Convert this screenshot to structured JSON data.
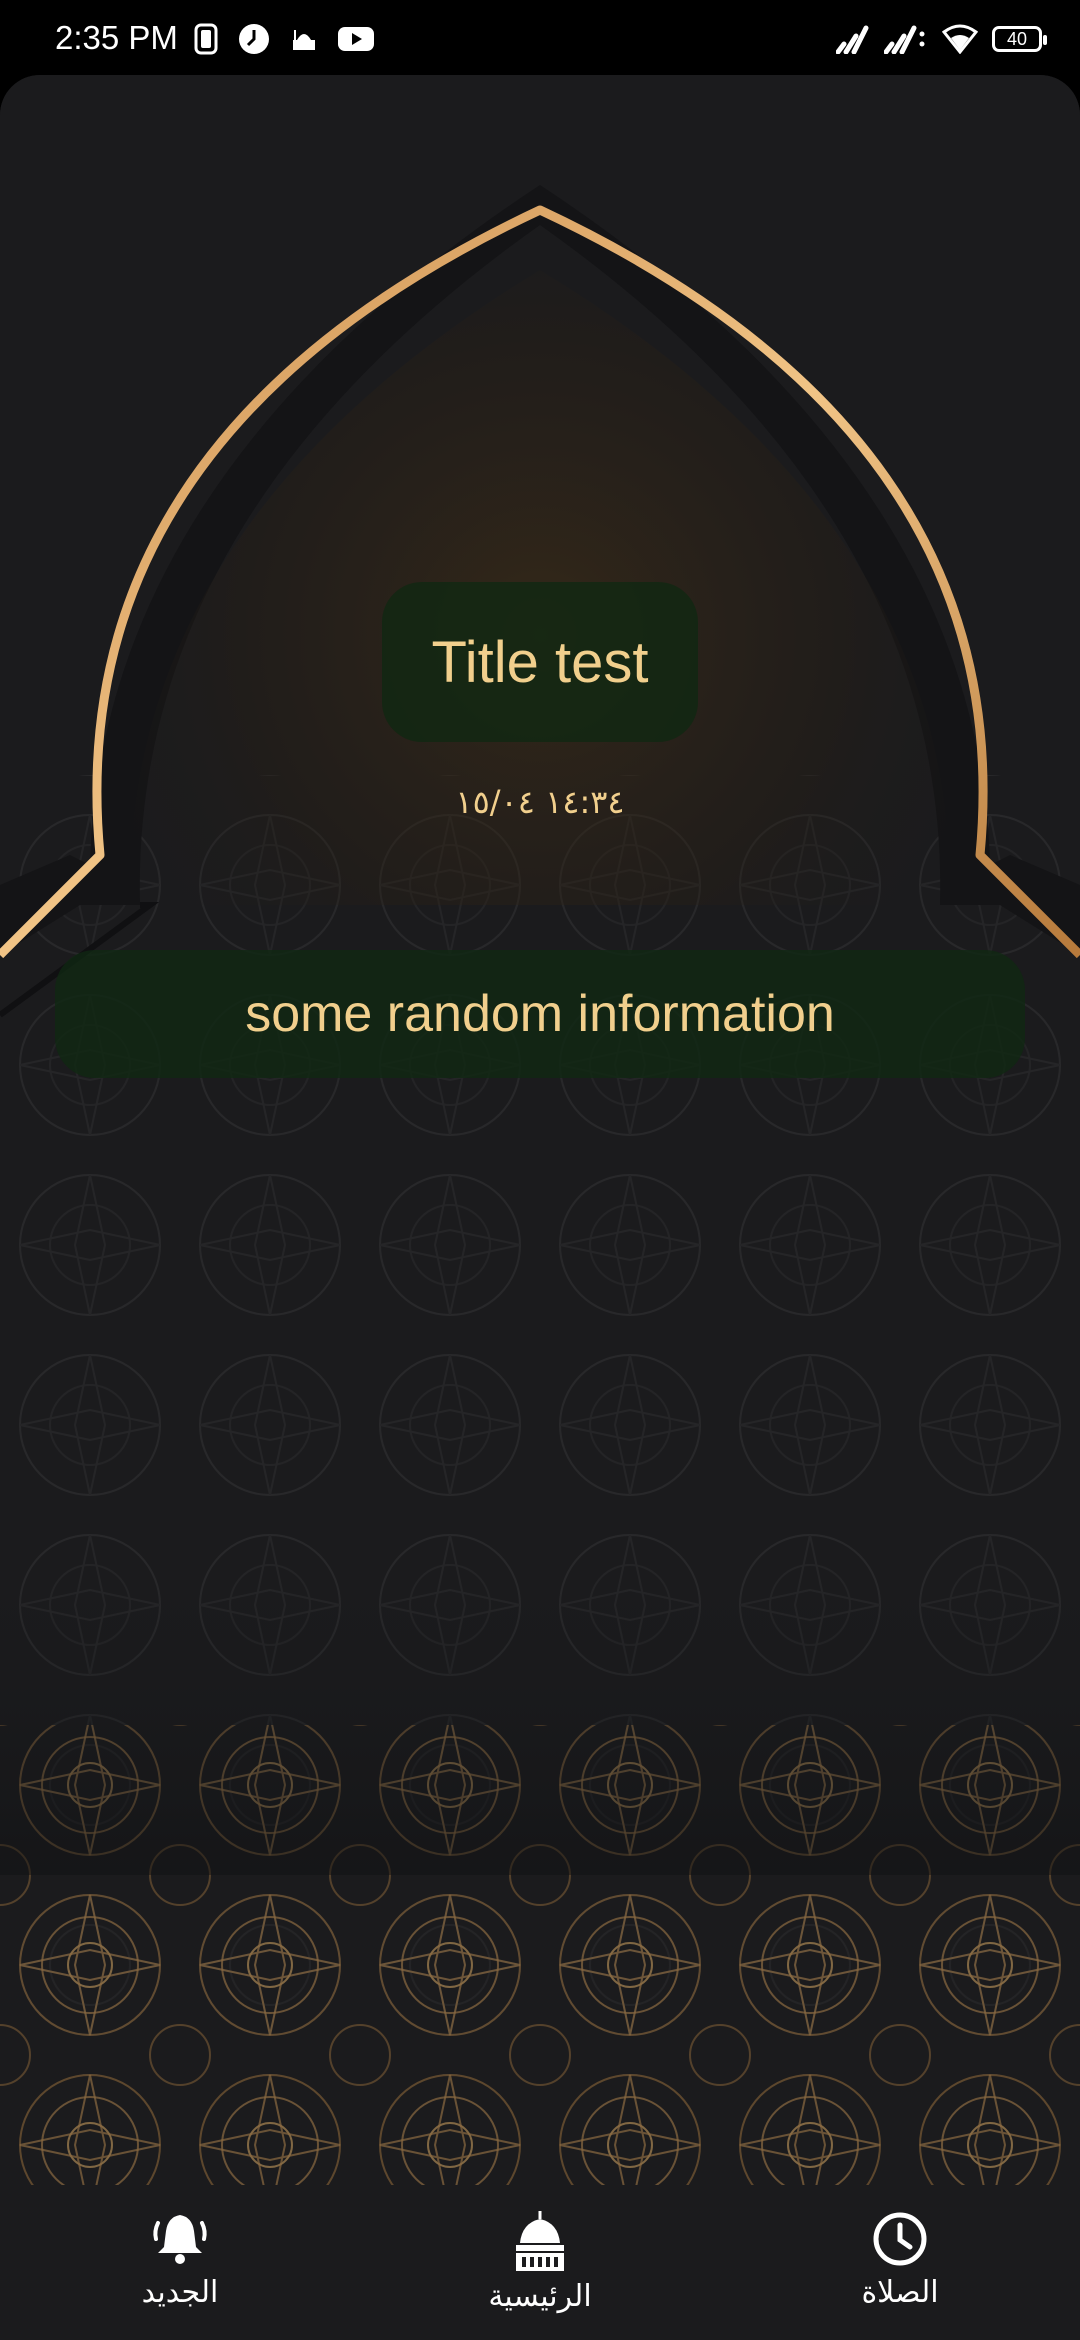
{
  "status_bar": {
    "time": "2:35 PM",
    "battery": "40",
    "left_icons": [
      "screen-record-icon",
      "clock-app-icon",
      "mosque-app-icon",
      "youtube-icon"
    ],
    "right_icons": [
      "signal-icon",
      "signal-icon-2",
      "wifi-icon",
      "battery-icon"
    ]
  },
  "main": {
    "title": "Title test",
    "date": "١٤:٣٤ ١٥/٠٤",
    "info": "some random information"
  },
  "bottom_nav": {
    "items": [
      {
        "label": "الجديد",
        "icon": "bell-icon"
      },
      {
        "label": "الرئيسية",
        "icon": "mosque-dome-icon"
      },
      {
        "label": "الصلاة",
        "icon": "clock-icon"
      }
    ]
  },
  "colors": {
    "accent_gold": "#f1cf8d",
    "pill_green": "#10281a",
    "background": "#1b1b1d"
  }
}
